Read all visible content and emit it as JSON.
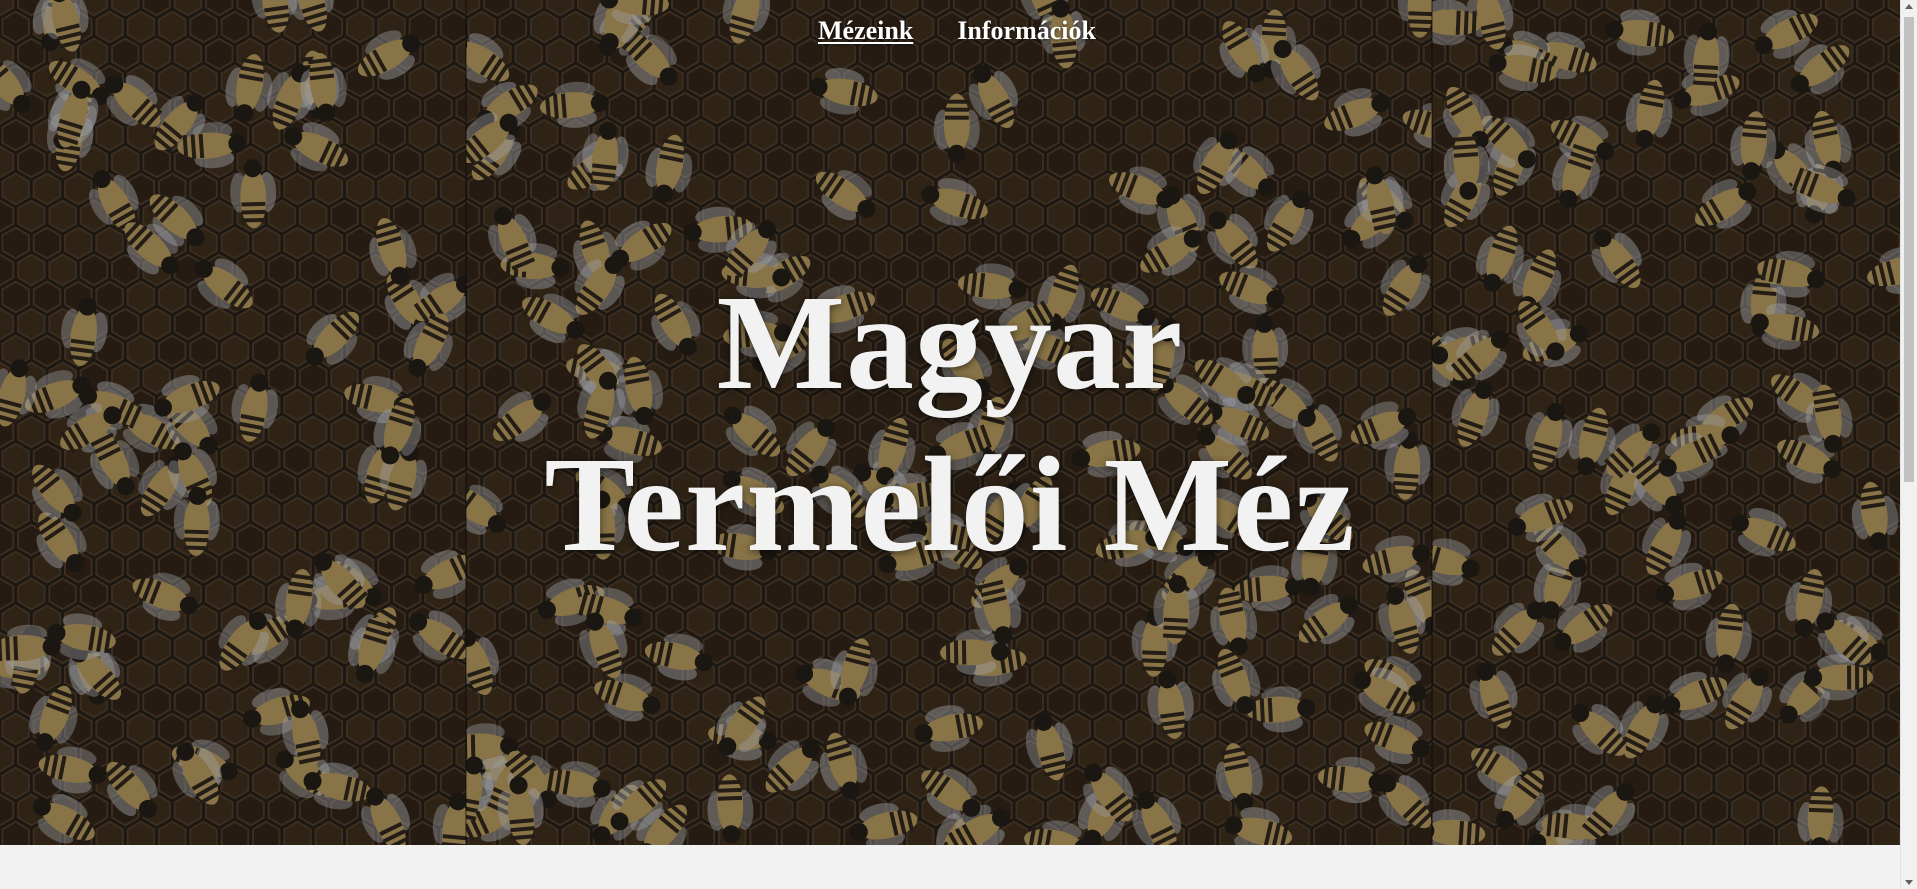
{
  "nav": {
    "items": [
      {
        "label": "Mézeink",
        "active": true
      },
      {
        "label": "Információk",
        "active": false
      }
    ]
  },
  "hero": {
    "title_line1": "Magyar",
    "title_line2": "Termelői Méz",
    "background_image": "bees-on-honeycomb",
    "colors": {
      "title": "#f2f2f2",
      "nav_text": "#ffffff",
      "honeycomb_dark": "#1e1a14",
      "bee_body": "#b49a5c",
      "bee_stripe": "#2a2218"
    }
  },
  "page": {
    "background": "#f2f2f2"
  }
}
